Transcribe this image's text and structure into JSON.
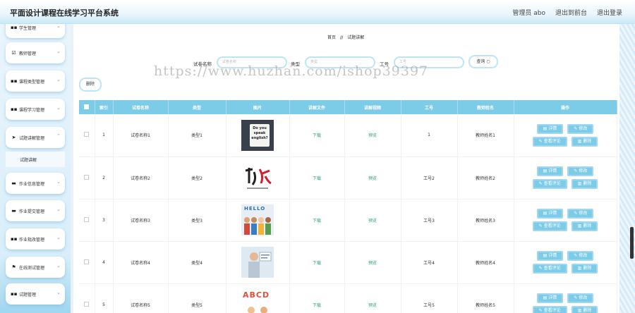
{
  "app": {
    "title": "平面设计课程在线学习平台系统",
    "user_label": "管理员 abo",
    "to_front": "退出到前台",
    "logout": "退出登录"
  },
  "sidebar": {
    "items": [
      {
        "label": "学生管理",
        "icon": "grid-icon"
      },
      {
        "label": "教师管理",
        "icon": "checkbox-icon"
      },
      {
        "label": "课程类型管理",
        "icon": "grid-icon"
      },
      {
        "label": "课程学习管理",
        "icon": "grid-icon"
      },
      {
        "label": "试题讲解管理",
        "icon": "send-icon"
      },
      {
        "label": "作业信息管理",
        "icon": "monitor-icon"
      },
      {
        "label": "作业提交管理",
        "icon": "chat-icon"
      },
      {
        "label": "作业批改管理",
        "icon": "grid-icon"
      },
      {
        "label": "在线测试管理",
        "icon": "flag-icon"
      },
      {
        "label": "试题管理",
        "icon": "grid-icon"
      }
    ],
    "sub_item": "试题讲解"
  },
  "breadcrumb": {
    "home": "首页",
    "sep": "//",
    "current": "试题讲解"
  },
  "search": {
    "name_label": "试卷名称",
    "name_placeholder": "试卷名称",
    "type_label": "类型",
    "type_placeholder": "类型",
    "no_label": "工号",
    "no_placeholder": "工号",
    "search_btn": "查询"
  },
  "delete_btn": "删除",
  "table": {
    "headers": [
      "索引",
      "试卷名称",
      "类型",
      "图片",
      "讲解文件",
      "讲解视频",
      "工号",
      "教师姓名",
      "操作"
    ],
    "rows": [
      {
        "index": "1",
        "name": "试卷名称1",
        "type": "类型1",
        "file": "下载",
        "video": "预览",
        "no": "1",
        "teacher": "教师姓名1"
      },
      {
        "index": "2",
        "name": "试卷名称2",
        "type": "类型2",
        "file": "下载",
        "video": "预览",
        "no": "工号2",
        "teacher": "教师姓名2"
      },
      {
        "index": "3",
        "name": "试卷名称3",
        "type": "类型3",
        "file": "下载",
        "video": "预览",
        "no": "工号3",
        "teacher": "教师姓名3"
      },
      {
        "index": "4",
        "name": "试卷名称4",
        "type": "类型4",
        "file": "下载",
        "video": "预览",
        "no": "工号4",
        "teacher": "教师姓名4"
      },
      {
        "index": "5",
        "name": "试卷名称5",
        "type": "类型5",
        "file": "下载",
        "video": "预览",
        "no": "工号5",
        "teacher": "教师姓名5"
      }
    ],
    "actions": {
      "detail": "详情",
      "edit": "修改",
      "comments": "查看评论",
      "delete": "删除"
    }
  },
  "thumb_texts": {
    "row1": "Do you speak english?",
    "row3": "HELLO",
    "row5": "ABCD"
  },
  "watermark": "https://www.huzhan.com/ishop39397"
}
